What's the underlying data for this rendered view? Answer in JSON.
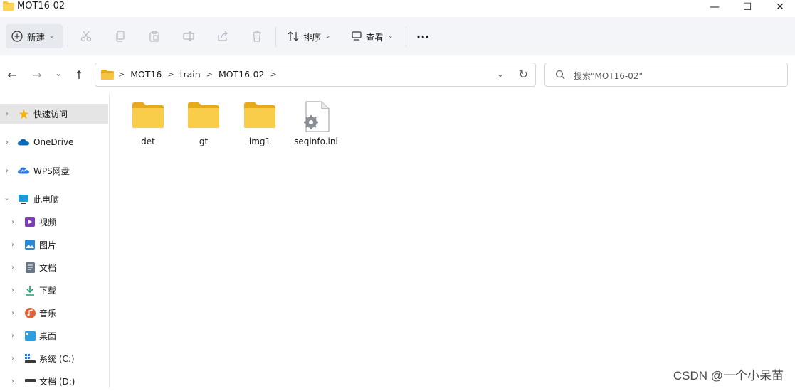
{
  "window": {
    "title": "MOT16-02",
    "minimize": "—",
    "maximize": "☐",
    "close": "✕"
  },
  "toolbar": {
    "new_label": "新建",
    "sort_label": "排序",
    "view_label": "查看",
    "more_label": "···",
    "icons": [
      "cut-icon",
      "copy-icon",
      "paste-icon",
      "rename-icon",
      "share-icon",
      "delete-icon"
    ]
  },
  "nav": {
    "back": "←",
    "forward": "→",
    "recent": "⌄",
    "up": "↑",
    "breadcrumbs": [
      "MOT16",
      "train",
      "MOT16-02"
    ],
    "crumb_separator": ">",
    "dropdown": "⌄",
    "refresh": "↻",
    "search_placeholder": "搜索\"MOT16-02\""
  },
  "sidebar": {
    "items": [
      {
        "label": "快速访问",
        "icon": "star-icon",
        "color": "#f5b400"
      },
      {
        "label": "OneDrive",
        "icon": "cloud-icon",
        "color": "#0f6cbd"
      },
      {
        "label": "WPS网盘",
        "icon": "wps-cloud-icon",
        "color": "#2e7be6"
      },
      {
        "label": "此电脑",
        "icon": "computer-icon",
        "color": "#1e9ad6"
      },
      {
        "label": "视频",
        "icon": "video-icon",
        "color": "#7b3fb5"
      },
      {
        "label": "图片",
        "icon": "pictures-icon",
        "color": "#2a88d8"
      },
      {
        "label": "文档",
        "icon": "documents-icon",
        "color": "#6b7786"
      },
      {
        "label": "下载",
        "icon": "download-icon",
        "color": "#1f9e6a"
      },
      {
        "label": "音乐",
        "icon": "music-icon",
        "color": "#e0643b"
      },
      {
        "label": "桌面",
        "icon": "desktop-icon",
        "color": "#2f9ee0"
      },
      {
        "label": "系统 (C:)",
        "icon": "drive-c-icon",
        "color": "#3a3a3a"
      },
      {
        "label": "文档 (D:)",
        "icon": "drive-d-icon",
        "color": "#3a3a3a"
      }
    ]
  },
  "files": [
    {
      "name": "det",
      "type": "folder"
    },
    {
      "name": "gt",
      "type": "folder"
    },
    {
      "name": "img1",
      "type": "folder"
    },
    {
      "name": "seqinfo.ini",
      "type": "ini"
    }
  ],
  "colors": {
    "folder": "#f6c343",
    "folder_dark": "#e8a91a",
    "toolbar_bg": "#f3f5f9"
  },
  "watermark": "CSDN @一个小呆苗"
}
